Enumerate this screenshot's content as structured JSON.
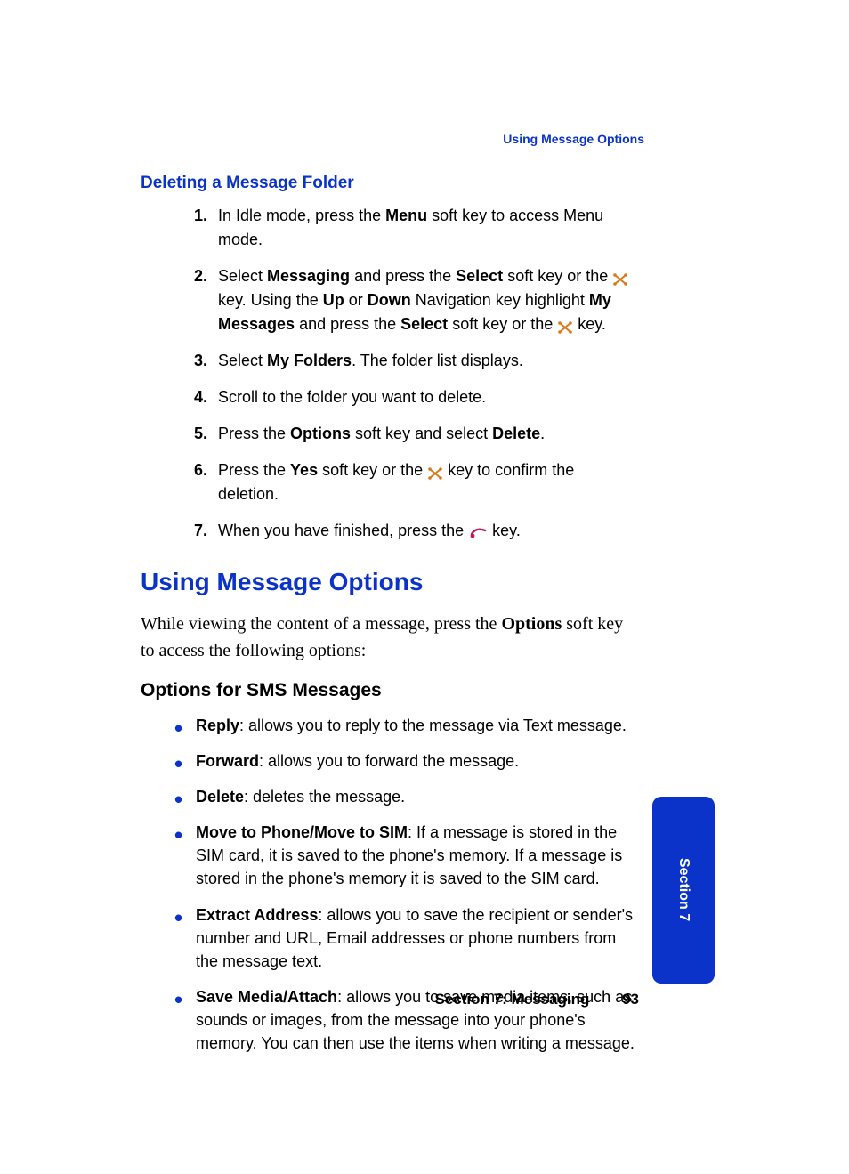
{
  "header": {
    "running_head": "Using Message Options"
  },
  "section1": {
    "heading": "Deleting a Message Folder",
    "steps": [
      {
        "num": "1.",
        "pre": "In Idle mode, press the ",
        "b1": "Menu",
        "post": " soft key to access Menu mode."
      },
      {
        "num": "2.",
        "t1": "Select ",
        "b1": "Messaging",
        "t2": " and press the ",
        "b2": "Select",
        "t3": " soft key or the ",
        "icon1": "x",
        "t4": " key. Using the ",
        "b3": "Up",
        "t5": " or ",
        "b4": "Down",
        "t6": " Navigation key highlight ",
        "b5": "My Messages",
        "t7": " and press the ",
        "b6": "Select",
        "t8": " soft key or the ",
        "icon2": "x",
        "t9": " key."
      },
      {
        "num": "3.",
        "t1": "Select ",
        "b1": "My Folders",
        "t2": ". The folder list displays."
      },
      {
        "num": "4.",
        "t1": "Scroll to the folder you want to delete."
      },
      {
        "num": "5.",
        "t1": "Press the ",
        "b1": "Options",
        "t2": " soft key and select ",
        "b2": "Delete",
        "t3": "."
      },
      {
        "num": "6.",
        "t1": "Press the ",
        "b1": "Yes",
        "t2": " soft key or the ",
        "icon1": "x",
        "t3": " key to confirm the deletion."
      },
      {
        "num": "7.",
        "t1": "When you have finished, press the ",
        "icon1": "end",
        "t2": " key."
      }
    ]
  },
  "section2": {
    "heading": "Using Message Options",
    "intro_pre": "While viewing the content of a message, press the ",
    "intro_bold": "Options",
    "intro_post": " soft key to access the following options:",
    "sub_heading": "Options for SMS Messages",
    "bullets": [
      {
        "b": "Reply",
        "t": ": allows you to reply to the message via Text message."
      },
      {
        "b": "Forward",
        "t": ": allows you to forward the message."
      },
      {
        "b": "Delete",
        "t": ": deletes the message."
      },
      {
        "b": "Move to Phone/Move to SIM",
        "t": ": If a message is stored in the SIM card, it is saved to the phone's memory. If a message is stored in the phone's memory it is saved to the SIM card."
      },
      {
        "b": "Extract Address",
        "t": ": allows you to save the recipient or sender's number and URL, Email addresses or phone numbers from the message text."
      },
      {
        "b": "Save Media/Attach",
        "t": ": allows you to save media items, such as sounds or images, from the message into your phone's memory. You can then use the items when writing a message."
      }
    ]
  },
  "sidetab": "Section 7",
  "footer": {
    "label": "Section 7: Messaging",
    "page": "93"
  }
}
